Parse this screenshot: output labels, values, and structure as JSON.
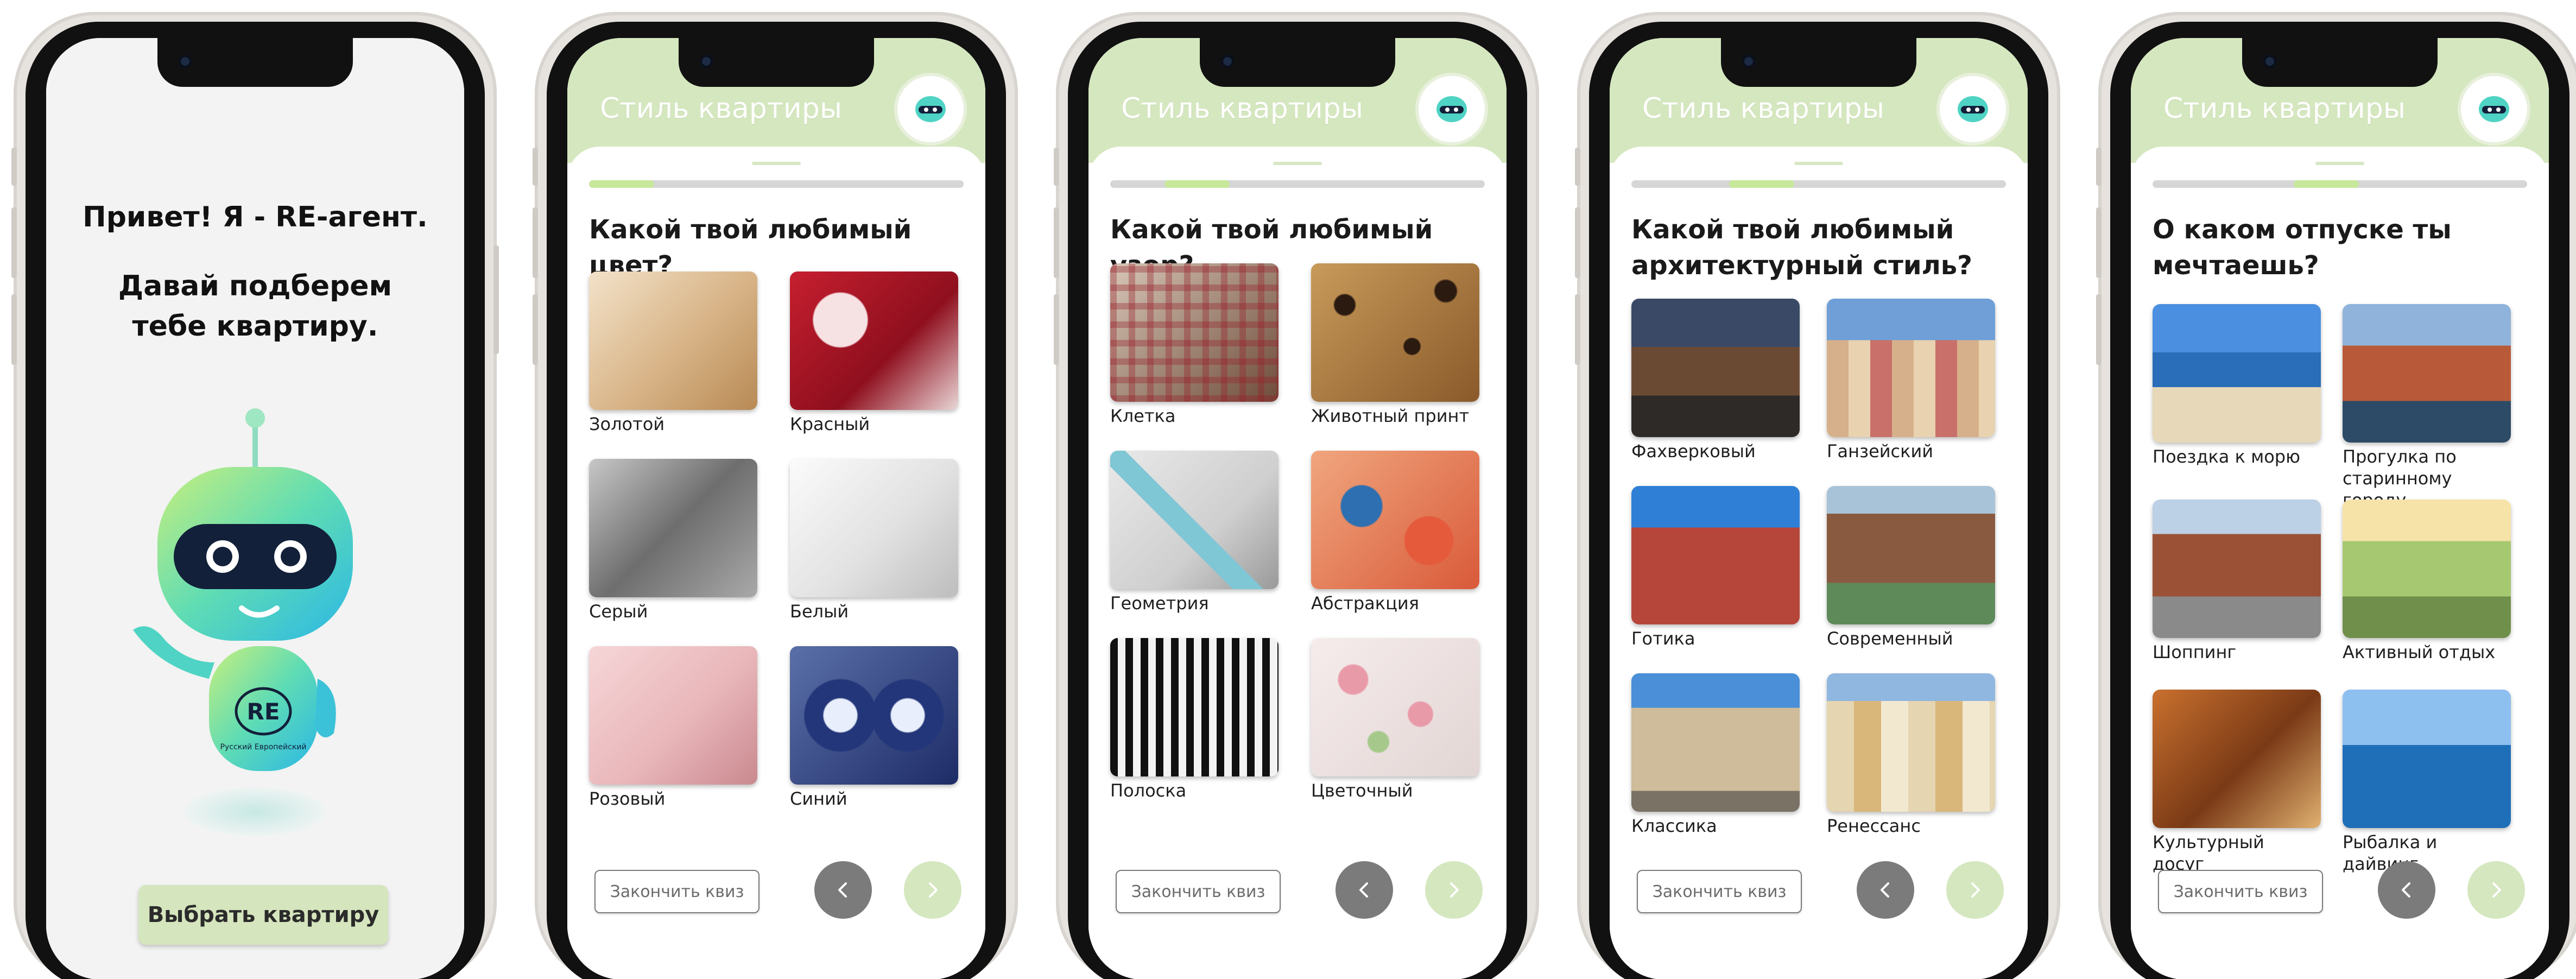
{
  "welcome": {
    "greeting": "Привет! Я - RE-агент.",
    "offer_line1": "Давай подберем",
    "offer_line2": "тебе квартиру.",
    "robot_badge": "RE",
    "robot_badge_sub": "Русский Европейский",
    "cta_label": "Выбрать квартиру"
  },
  "colors": {
    "header": "#d5e7bf",
    "progress_track": "#d6d6d6",
    "progress_fill": "#c7e79a",
    "prev_button": "#7b7b7b",
    "next_button": "#d5e7bf"
  },
  "quizzes": [
    {
      "header_title": "Стиль квартиры",
      "question": "Какой твой любимый цвет?",
      "progress": 0.1,
      "options": [
        {
          "label": "Золотой",
          "icon": "cushion-photo"
        },
        {
          "label": "Красный",
          "icon": "cushion-photo"
        },
        {
          "label": "Серый",
          "icon": "cushion-photo"
        },
        {
          "label": "Белый",
          "icon": "cushion-photo"
        },
        {
          "label": "Розовый",
          "icon": "cushion-photo"
        },
        {
          "label": "Синий",
          "icon": "cushion-photo"
        }
      ],
      "finish_label": "Закончить квиз"
    },
    {
      "header_title": "Стиль квартиры",
      "question": "Какой твой любимый узор?",
      "progress": 0.25,
      "options": [
        {
          "label": "Клетка",
          "icon": "interior-photo"
        },
        {
          "label": "Животный принт",
          "icon": "interior-photo"
        },
        {
          "label": "Геометрия",
          "icon": "interior-photo"
        },
        {
          "label": "Абстракция",
          "icon": "interior-photo"
        },
        {
          "label": "Полоска",
          "icon": "interior-photo"
        },
        {
          "label": "Цветочный",
          "icon": "interior-photo"
        }
      ],
      "finish_label": "Закончить квиз"
    },
    {
      "header_title": "Стиль квартиры",
      "question": "Какой твой любимый архитектурный стиль?",
      "progress": 0.4,
      "options": [
        {
          "label": "Фахверковый",
          "icon": "building-photo"
        },
        {
          "label": "Ганзейский",
          "icon": "building-photo"
        },
        {
          "label": "Готика",
          "icon": "building-photo"
        },
        {
          "label": "Современный",
          "icon": "building-photo"
        },
        {
          "label": "Классика",
          "icon": "building-photo"
        },
        {
          "label": "Ренессанс",
          "icon": "building-photo"
        }
      ],
      "finish_label": "Закончить квиз"
    },
    {
      "header_title": "Стиль квартиры",
      "question": "О каком отпуске ты мечтаешь?",
      "progress": 0.5,
      "options": [
        {
          "label": "Поездка к морю",
          "icon": "vacation-photo"
        },
        {
          "label": "Прогулка по старинному городу",
          "icon": "vacation-photo"
        },
        {
          "label": "Шоппинг",
          "icon": "vacation-photo"
        },
        {
          "label": "Активный отдых",
          "icon": "vacation-photo"
        },
        {
          "label": "Культурный досуг",
          "icon": "vacation-photo"
        },
        {
          "label": "Рыбалка и дайвинг",
          "icon": "vacation-photo"
        }
      ],
      "finish_label": "Закончить квиз"
    }
  ]
}
